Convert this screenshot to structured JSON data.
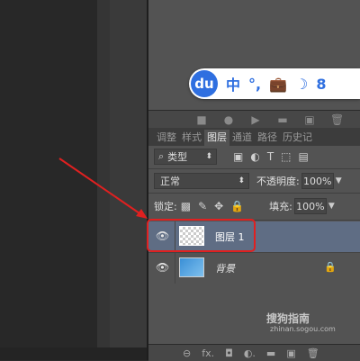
{
  "ime": {
    "logo": "du",
    "items": [
      "中",
      "°,",
      "💼",
      "☽",
      "8"
    ]
  },
  "top_toolbar": {
    "icons": [
      "■",
      "●",
      "▶",
      "▬",
      "▣",
      "🗑"
    ]
  },
  "tabs": [
    {
      "label": "调整",
      "active": false
    },
    {
      "label": "样式",
      "active": false
    },
    {
      "label": "图层",
      "active": true
    },
    {
      "label": "通道",
      "active": false
    },
    {
      "label": "路径",
      "active": false
    },
    {
      "label": "历史记",
      "active": false
    }
  ],
  "filter": {
    "value": "类型",
    "arrow": "⬍"
  },
  "blend": {
    "mode": "正常",
    "arrow": "⬍",
    "opacity_label": "不透明度:",
    "opacity_value": "100%"
  },
  "lock": {
    "label": "锁定:",
    "fill_label": "填充:",
    "fill_value": "100%"
  },
  "layers": [
    {
      "name": "图层 1",
      "selected": true
    },
    {
      "name": "背景",
      "selected": false
    }
  ],
  "bottom_icons": [
    "⊖",
    "fx.",
    "◘",
    "◐.",
    "▬",
    "▣",
    "🗑"
  ],
  "watermark": {
    "brand": "搜狗指南",
    "url": "zhinan.sogou.com"
  },
  "colors": {
    "highlight": "#e02020",
    "arrow": "#e02020",
    "selected_layer": "#5f6d84"
  }
}
